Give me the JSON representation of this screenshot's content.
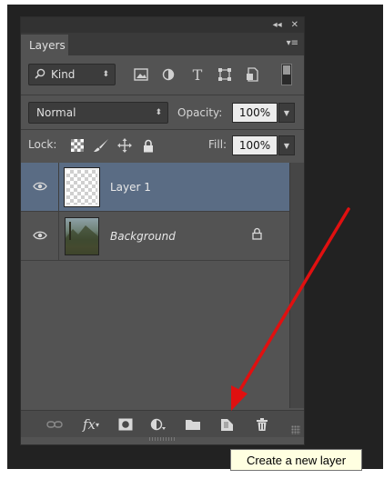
{
  "window": {
    "collapse_glyph": "◂◂",
    "close_glyph": "✕"
  },
  "panel": {
    "tab_label": "Layers",
    "menu_glyph": "▾≡"
  },
  "filter": {
    "kind_label": "Kind",
    "kind_arrow": "⬍"
  },
  "blend": {
    "mode": "Normal",
    "mode_arrow": "⬍",
    "opacity_label": "Opacity:",
    "opacity_value": "100%"
  },
  "lock": {
    "label": "Lock:",
    "fill_label": "Fill:",
    "fill_value": "100%"
  },
  "layers": [
    {
      "name": "Layer 1",
      "selected": true,
      "locked": false
    },
    {
      "name": "Background",
      "selected": false,
      "locked": true
    }
  ],
  "tooltip": {
    "text": "Create a new layer"
  },
  "colors": {
    "panel": "#535353",
    "selected": "#5a6c84",
    "arrow": "#e01010",
    "tooltip_bg": "#ffffe1"
  },
  "icons": {
    "filter": [
      "image-filter-icon",
      "adjustment-filter-icon",
      "type-filter-icon",
      "shape-filter-icon",
      "smart-object-filter-icon"
    ],
    "lock": [
      "lock-transparent-pixels-icon",
      "lock-image-pixels-icon",
      "lock-position-icon",
      "lock-all-icon"
    ],
    "bottom": [
      "link-layers-icon",
      "layer-style-icon",
      "add-mask-icon",
      "adjustment-layer-icon",
      "new-group-icon",
      "new-layer-icon",
      "delete-layer-icon"
    ]
  }
}
